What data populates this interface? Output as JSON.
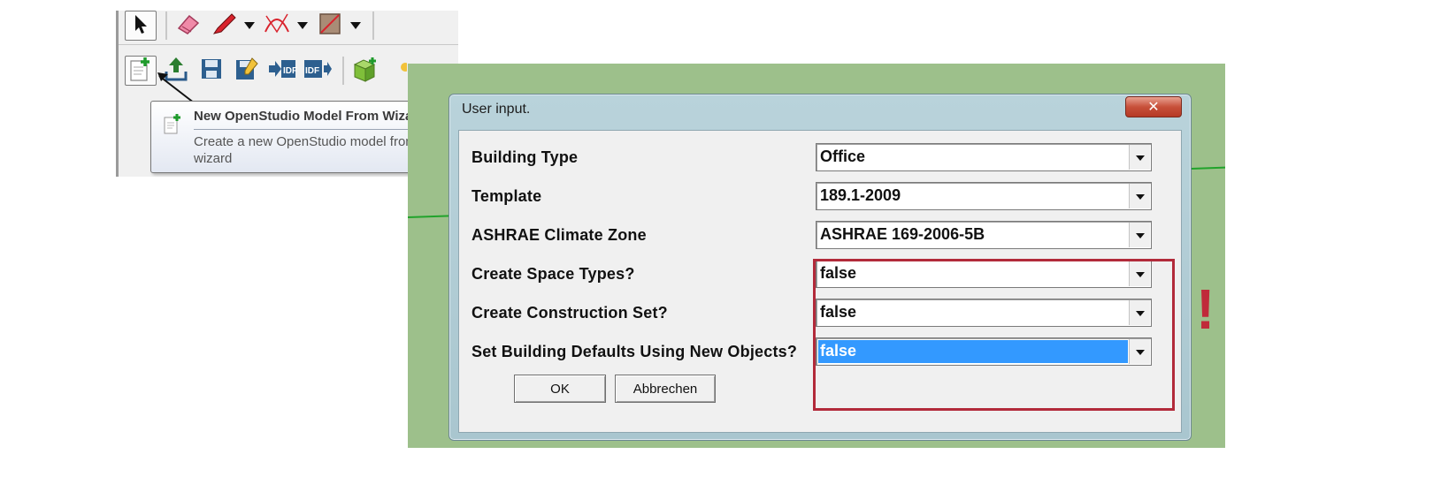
{
  "toolbar": {
    "row1_icons": [
      "select-arrow-icon",
      "eraser-icon",
      "pencil-line-icon",
      "arc-icon",
      "rectangle-icon"
    ],
    "row2_icons": [
      "new-model-wizard-icon",
      "import-icon",
      "save-icon",
      "save-as-icon",
      "export-idf-icon",
      "import-idf-icon",
      "add-space-icon"
    ]
  },
  "tooltip": {
    "title": "New OpenStudio Model From Wizard",
    "description": "Create a new OpenStudio model from a wizard"
  },
  "dialog": {
    "title": "User input.",
    "close_label": "✕",
    "fields": [
      {
        "label": "Building Type",
        "value": "Office"
      },
      {
        "label": "Template",
        "value": "189.1-2009"
      },
      {
        "label": "ASHRAE Climate Zone",
        "value": "ASHRAE 169-2006-5B"
      },
      {
        "label": "Create Space Types?",
        "value": "false"
      },
      {
        "label": "Create Construction Set?",
        "value": "false"
      },
      {
        "label": "Set Building Defaults Using New Objects?",
        "value": "false"
      }
    ],
    "ok_label": "OK",
    "cancel_label": "Abbrechen"
  },
  "annotation": {
    "mark": "!",
    "highlight_color": "#b22a3a"
  },
  "colors": {
    "canvas_green": "#9dc08b",
    "selection_blue": "#3399ff",
    "close_red": "#c7503a"
  }
}
